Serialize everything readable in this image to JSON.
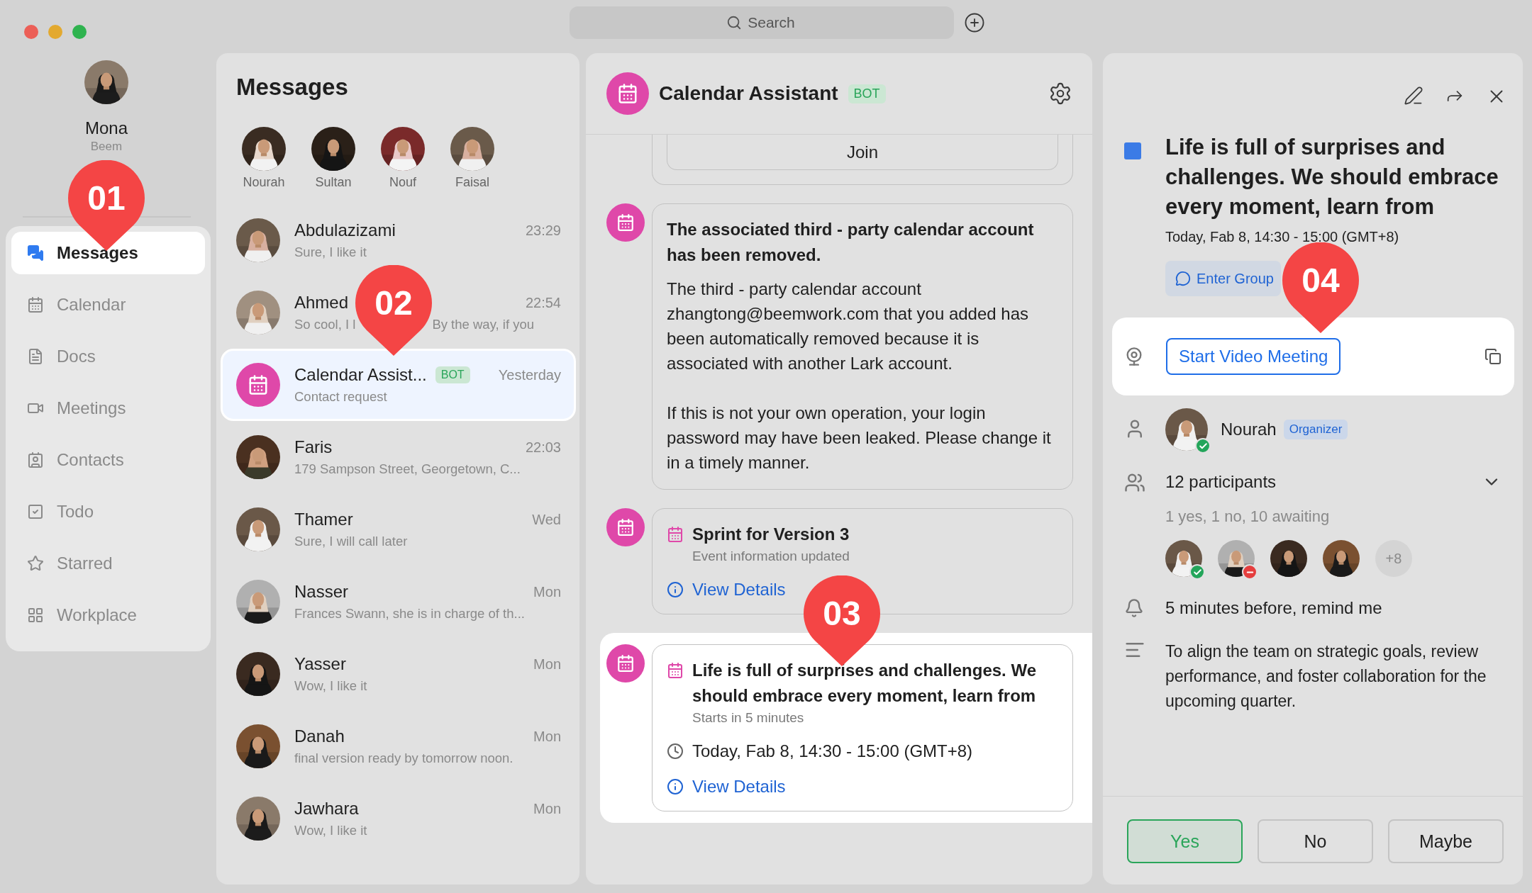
{
  "search": {
    "placeholder": "Search"
  },
  "profile": {
    "name": "Mona",
    "org": "Beem"
  },
  "nav": [
    {
      "label": "Messages",
      "selected": true
    },
    {
      "label": "Calendar",
      "selected": false
    },
    {
      "label": "Docs",
      "selected": false
    },
    {
      "label": "Meetings",
      "selected": false
    },
    {
      "label": "Contacts",
      "selected": false
    },
    {
      "label": "Todo",
      "selected": false
    },
    {
      "label": "Starred",
      "selected": false
    },
    {
      "label": "Workplace",
      "selected": false
    }
  ],
  "messages": {
    "title": "Messages",
    "pinned": [
      {
        "name": "Nourah"
      },
      {
        "name": "Sultan"
      },
      {
        "name": "Nouf"
      },
      {
        "name": "Faisal"
      }
    ],
    "conversations": [
      {
        "kind": "person",
        "name": "Abdulazizami",
        "preview": "Sure, I like it",
        "time": "23:29",
        "selected": false
      },
      {
        "kind": "person",
        "name": "Ahmed",
        "preview": [
          "So cool, I l",
          "By the way, if you"
        ],
        "time": "22:54",
        "selected": false
      },
      {
        "kind": "bot",
        "name": "Calendar Assist...",
        "badge": "BOT",
        "preview": "Contact request",
        "time": "Yesterday",
        "selected": true
      },
      {
        "kind": "person",
        "name": "Faris",
        "preview": "179 Sampson Street, Georgetown, C...",
        "time": "22:03",
        "selected": false
      },
      {
        "kind": "person",
        "name": "Thamer",
        "preview": "Sure, I will call later",
        "time": "Wed",
        "selected": false
      },
      {
        "kind": "person",
        "name": "Nasser",
        "preview": "Frances Swann, she is in charge of th...",
        "time": "Mon",
        "selected": false
      },
      {
        "kind": "person",
        "name": "Yasser",
        "preview": "Wow, I like it",
        "time": "Mon",
        "selected": false
      },
      {
        "kind": "person",
        "name": "Danah",
        "preview": "final version ready by tomorrow noon.",
        "time": "Mon",
        "selected": false
      },
      {
        "kind": "person",
        "name": "Jawhara",
        "preview": "Wow, I like it",
        "time": "Mon",
        "selected": false
      }
    ]
  },
  "chat": {
    "title": "Calendar Assistant",
    "badge": "BOT",
    "cards": [
      {
        "kind": "join",
        "button": "Join",
        "highlighted": false
      },
      {
        "kind": "notice",
        "title": "The associated third - party calendar account has been removed.",
        "paragraphs": [
          "The third - party calendar account zhangtong@beemwork.com that you added has been automatically removed because it is associated with another Lark account.",
          "If this is not your own operation, your login password may have been leaked. Please change it in a timely manner."
        ],
        "highlighted": false
      },
      {
        "kind": "event",
        "title": "Sprint for Version 3",
        "subtitle": "Event information updated",
        "link": "View Details",
        "highlighted": false
      },
      {
        "kind": "event",
        "title": "Life is full of surprises and challenges. We should embrace every moment, learn from",
        "subtitle": "Starts in 5 minutes",
        "time": "Today, Fab 8, 14:30 - 15:00 (GMT+8)",
        "link": "View Details",
        "highlighted": true
      }
    ]
  },
  "detail": {
    "title": "Life is full of surprises and challenges. We should embrace every moment, learn from",
    "time": "Today, Fab 8, 14:30 - 15:00 (GMT+8)",
    "group_button": "Enter Group",
    "video": {
      "button": "Start Video Meeting",
      "highlighted": true
    },
    "organizer": {
      "name": "Nourah",
      "badge": "Organizer",
      "accepted": true,
      "declined": false
    },
    "participants": {
      "label": "12 participants",
      "expanded": false,
      "summary": "1 yes, 1 no, 10 awaiting",
      "avatars": [
        {
          "accepted": true,
          "declined": false
        },
        {
          "accepted": false,
          "declined": true
        },
        {
          "accepted": false,
          "declined": false
        },
        {
          "accepted": false,
          "declined": false
        }
      ],
      "more": "+8"
    },
    "reminder": "5 minutes before, remind me",
    "description": "To align the team on strategic goals, review performance, and foster collaboration for the upcoming quarter.",
    "rsvp": [
      {
        "label": "Yes",
        "selected": true
      },
      {
        "label": "No",
        "selected": false
      },
      {
        "label": "Maybe",
        "selected": false
      }
    ]
  },
  "callouts": [
    {
      "label": "01"
    },
    {
      "label": "02"
    },
    {
      "label": "03"
    },
    {
      "label": "04"
    }
  ]
}
